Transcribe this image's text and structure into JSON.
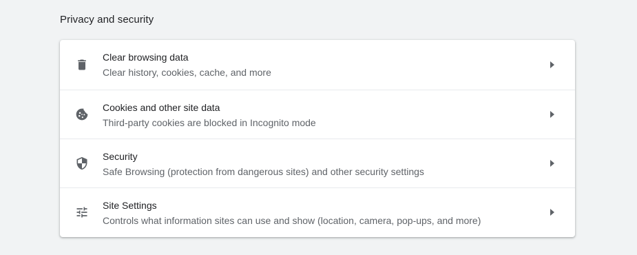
{
  "section": {
    "title": "Privacy and security"
  },
  "items": [
    {
      "icon": "trash-icon",
      "title": "Clear browsing data",
      "subtitle": "Clear history, cookies, cache, and more"
    },
    {
      "icon": "cookie-icon",
      "title": "Cookies and other site data",
      "subtitle": "Third-party cookies are blocked in Incognito mode"
    },
    {
      "icon": "shield-icon",
      "title": "Security",
      "subtitle": "Safe Browsing (protection from dangerous sites) and other security settings"
    },
    {
      "icon": "tune-icon",
      "title": "Site Settings",
      "subtitle": "Controls what information sites can use and show (location, camera, pop-ups, and more)"
    }
  ],
  "colors": {
    "background": "#f1f3f4",
    "card": "#ffffff",
    "text_primary": "#202124",
    "text_secondary": "#5f6368",
    "icon": "#5f6368"
  }
}
